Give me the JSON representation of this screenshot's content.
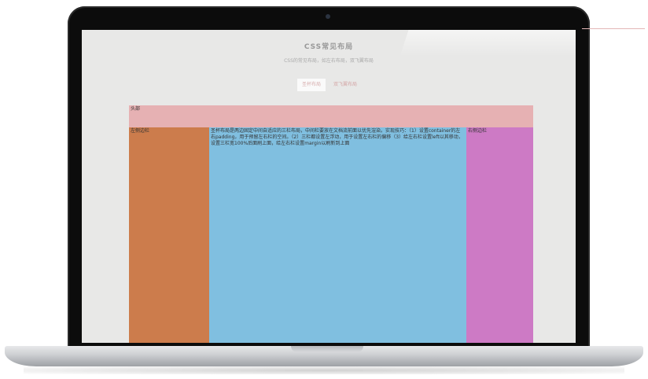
{
  "page": {
    "title": "CSS常见布局",
    "subtitle": "CSS的常见布局，如左右布局，双飞翼布局",
    "nav": [
      {
        "label": "圣杯布局"
      },
      {
        "label": "双飞翼布局"
      }
    ]
  },
  "layout": {
    "header": "头部",
    "left": "左侧边栏",
    "center": "圣杯布局是两边固定中间自适应的三栏布局，中间栏要放在文档流前面以优先渲染。实现技巧：（1）设置container的左右padding，用于预留左右栏的空间。（2）三栏都设置左浮动，用于设置左右栏的偏移（3）给左右栏设置left以其移动，设置三栏宽100%后面刷上面，给左右栏设置margin以刷新到上面",
    "right": "右侧边栏"
  },
  "colors": {
    "header": "#e6b1b3",
    "left": "#cc7c4c",
    "center": "#80bfe0",
    "right": "#cd7ac5",
    "screen_bg": "#e8e8e7"
  }
}
